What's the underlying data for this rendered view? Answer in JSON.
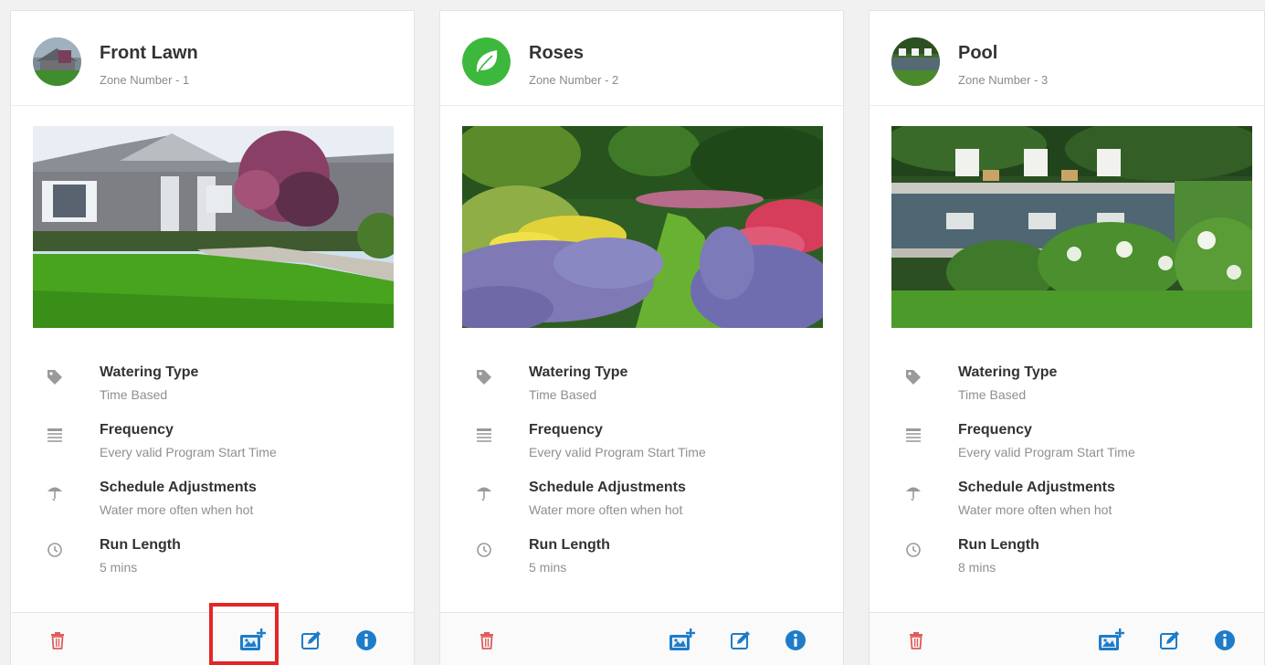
{
  "zones": [
    {
      "name": "Front Lawn",
      "zone_label": "Zone Number - 1",
      "properties": [
        {
          "title": "Watering Type",
          "value": "Time Based",
          "icon": "tag-icon"
        },
        {
          "title": "Frequency",
          "value": "Every valid Program Start Time",
          "icon": "calendar-icon"
        },
        {
          "title": "Schedule Adjustments",
          "value": "Water more often when hot",
          "icon": "umbrella-icon"
        },
        {
          "title": "Run Length",
          "value": "5 mins",
          "icon": "clock-icon"
        }
      ]
    },
    {
      "name": "Roses",
      "zone_label": "Zone Number - 2",
      "properties": [
        {
          "title": "Watering Type",
          "value": "Time Based",
          "icon": "tag-icon"
        },
        {
          "title": "Frequency",
          "value": "Every valid Program Start Time",
          "icon": "calendar-icon"
        },
        {
          "title": "Schedule Adjustments",
          "value": "Water more often when hot",
          "icon": "umbrella-icon"
        },
        {
          "title": "Run Length",
          "value": "5 mins",
          "icon": "clock-icon"
        }
      ]
    },
    {
      "name": "Pool",
      "zone_label": "Zone Number - 3",
      "properties": [
        {
          "title": "Watering Type",
          "value": "Time Based",
          "icon": "tag-icon"
        },
        {
          "title": "Frequency",
          "value": "Every valid Program Start Time",
          "icon": "calendar-icon"
        },
        {
          "title": "Schedule Adjustments",
          "value": "Water more often when hot",
          "icon": "umbrella-icon"
        },
        {
          "title": "Run Length",
          "value": "8 mins",
          "icon": "clock-icon"
        }
      ]
    }
  ],
  "footer_icons": [
    "trash-icon",
    "add-image-icon",
    "edit-icon",
    "info-icon"
  ],
  "colors": {
    "delete": "#e05a5a",
    "action": "#1e7cc8",
    "highlight": "#e32626",
    "leaf_badge": "#3cb83c"
  }
}
